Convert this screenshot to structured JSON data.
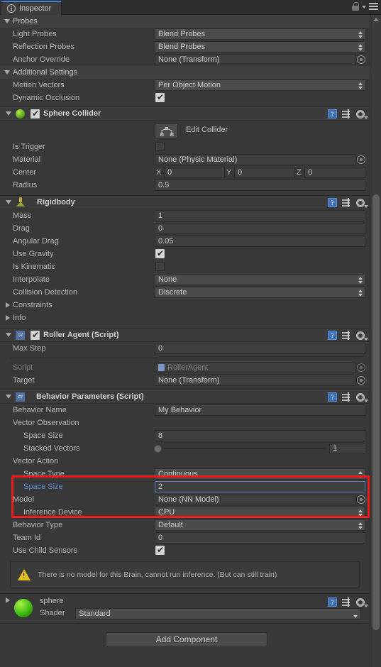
{
  "window": {
    "tab_label": "Inspector",
    "tab_icon": "info-icon",
    "lock_icon": "lock-icon",
    "menu_icon": "hamburger-menu-icon"
  },
  "renderer_tail": {
    "probes": {
      "header": "Probes",
      "rows": [
        {
          "label": "Light Probes",
          "value": "Blend Probes",
          "type": "dropdown"
        },
        {
          "label": "Reflection Probes",
          "value": "Blend Probes",
          "type": "dropdown"
        },
        {
          "label": "Anchor Override",
          "value": "None (Transform)",
          "type": "object"
        }
      ]
    },
    "additional_settings": {
      "header": "Additional Settings",
      "rows": [
        {
          "label": "Motion Vectors",
          "value": "Per Object Motion",
          "type": "dropdown"
        },
        {
          "label": "Dynamic Occlusion",
          "value": "",
          "type": "checkbox_on"
        }
      ]
    }
  },
  "sphere_collider": {
    "title": "Sphere Collider",
    "enabled": true,
    "edit_collider_label": "Edit Collider",
    "rows": [
      {
        "label": "Is Trigger",
        "value": "",
        "type": "checkbox_off"
      },
      {
        "label": "Material",
        "value": "None (Physic Material)",
        "type": "object"
      },
      {
        "label": "Center",
        "type": "vector3",
        "x_label": "X",
        "x": "0",
        "y_label": "Y",
        "y": "0",
        "z_label": "Z",
        "z": "0"
      },
      {
        "label": "Radius",
        "value": "0.5",
        "type": "number"
      }
    ]
  },
  "rigidbody": {
    "title": "Rigidbody",
    "rows": [
      {
        "label": "Mass",
        "value": "1",
        "type": "number"
      },
      {
        "label": "Drag",
        "value": "0",
        "type": "number"
      },
      {
        "label": "Angular Drag",
        "value": "0.05",
        "type": "number"
      },
      {
        "label": "Use Gravity",
        "value": "",
        "type": "checkbox_on"
      },
      {
        "label": "Is Kinematic",
        "value": "",
        "type": "checkbox_off"
      },
      {
        "label": "Interpolate",
        "value": "None",
        "type": "dropdown"
      },
      {
        "label": "Collision Detection",
        "value": "Discrete",
        "type": "dropdown"
      }
    ],
    "foldouts": [
      "Constraints",
      "Info"
    ]
  },
  "roller_agent": {
    "title": "Roller Agent (Script)",
    "enabled": true,
    "max_step": {
      "label": "Max Step",
      "value": "0"
    },
    "script": {
      "label": "Script",
      "value": "RollerAgent"
    },
    "target": {
      "label": "Target",
      "value": "None (Transform)"
    }
  },
  "behavior_parameters": {
    "title": "Behavior Parameters (Script)",
    "behavior_name": {
      "label": "Behavior Name",
      "value": "My Behavior"
    },
    "vector_observation": {
      "label": "Vector Observation",
      "space_size": {
        "label": "Space Size",
        "value": "8"
      },
      "stacked_vectors": {
        "label": "Stacked Vectors",
        "value": "1"
      }
    },
    "vector_action": {
      "label": "Vector Action",
      "space_type": {
        "label": "Space Type",
        "value": "Continuous"
      },
      "space_size": {
        "label": "Space Size",
        "value": "2",
        "focused": true
      }
    },
    "model": {
      "label": "Model",
      "value": "None (NN Model)"
    },
    "inference_device": {
      "label": "Inference Device",
      "value": "CPU"
    },
    "behavior_type": {
      "label": "Behavior Type",
      "value": "Default"
    },
    "team_id": {
      "label": "Team Id",
      "value": "0"
    },
    "use_child_sensors": {
      "label": "Use Child Sensors",
      "value": ""
    },
    "warning": "There is no model for this Brain, cannot run inference. (But can still train)"
  },
  "material": {
    "name": "sphere",
    "shader_label": "Shader",
    "shader_value": "Standard"
  },
  "footer": {
    "add_component": "Add Component"
  },
  "highlight": {
    "color": "#f01c1c"
  }
}
